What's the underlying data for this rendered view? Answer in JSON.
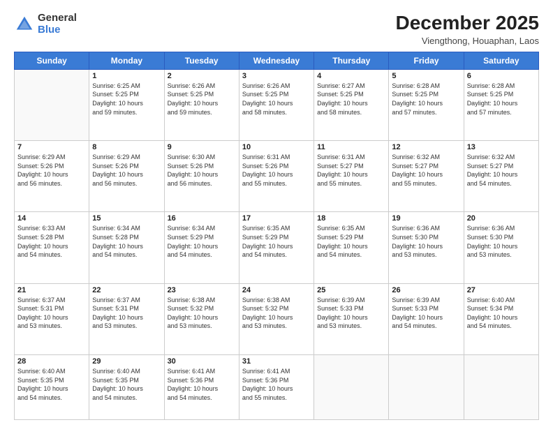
{
  "logo": {
    "general": "General",
    "blue": "Blue"
  },
  "header": {
    "month": "December 2025",
    "subtitle": "Viengthong, Houaphan, Laos"
  },
  "weekdays": [
    "Sunday",
    "Monday",
    "Tuesday",
    "Wednesday",
    "Thursday",
    "Friday",
    "Saturday"
  ],
  "weeks": [
    [
      {
        "day": "",
        "info": ""
      },
      {
        "day": "1",
        "info": "Sunrise: 6:25 AM\nSunset: 5:25 PM\nDaylight: 10 hours\nand 59 minutes."
      },
      {
        "day": "2",
        "info": "Sunrise: 6:26 AM\nSunset: 5:25 PM\nDaylight: 10 hours\nand 59 minutes."
      },
      {
        "day": "3",
        "info": "Sunrise: 6:26 AM\nSunset: 5:25 PM\nDaylight: 10 hours\nand 58 minutes."
      },
      {
        "day": "4",
        "info": "Sunrise: 6:27 AM\nSunset: 5:25 PM\nDaylight: 10 hours\nand 58 minutes."
      },
      {
        "day": "5",
        "info": "Sunrise: 6:28 AM\nSunset: 5:25 PM\nDaylight: 10 hours\nand 57 minutes."
      },
      {
        "day": "6",
        "info": "Sunrise: 6:28 AM\nSunset: 5:25 PM\nDaylight: 10 hours\nand 57 minutes."
      }
    ],
    [
      {
        "day": "7",
        "info": "Sunrise: 6:29 AM\nSunset: 5:26 PM\nDaylight: 10 hours\nand 56 minutes."
      },
      {
        "day": "8",
        "info": "Sunrise: 6:29 AM\nSunset: 5:26 PM\nDaylight: 10 hours\nand 56 minutes."
      },
      {
        "day": "9",
        "info": "Sunrise: 6:30 AM\nSunset: 5:26 PM\nDaylight: 10 hours\nand 56 minutes."
      },
      {
        "day": "10",
        "info": "Sunrise: 6:31 AM\nSunset: 5:26 PM\nDaylight: 10 hours\nand 55 minutes."
      },
      {
        "day": "11",
        "info": "Sunrise: 6:31 AM\nSunset: 5:27 PM\nDaylight: 10 hours\nand 55 minutes."
      },
      {
        "day": "12",
        "info": "Sunrise: 6:32 AM\nSunset: 5:27 PM\nDaylight: 10 hours\nand 55 minutes."
      },
      {
        "day": "13",
        "info": "Sunrise: 6:32 AM\nSunset: 5:27 PM\nDaylight: 10 hours\nand 54 minutes."
      }
    ],
    [
      {
        "day": "14",
        "info": "Sunrise: 6:33 AM\nSunset: 5:28 PM\nDaylight: 10 hours\nand 54 minutes."
      },
      {
        "day": "15",
        "info": "Sunrise: 6:34 AM\nSunset: 5:28 PM\nDaylight: 10 hours\nand 54 minutes."
      },
      {
        "day": "16",
        "info": "Sunrise: 6:34 AM\nSunset: 5:29 PM\nDaylight: 10 hours\nand 54 minutes."
      },
      {
        "day": "17",
        "info": "Sunrise: 6:35 AM\nSunset: 5:29 PM\nDaylight: 10 hours\nand 54 minutes."
      },
      {
        "day": "18",
        "info": "Sunrise: 6:35 AM\nSunset: 5:29 PM\nDaylight: 10 hours\nand 54 minutes."
      },
      {
        "day": "19",
        "info": "Sunrise: 6:36 AM\nSunset: 5:30 PM\nDaylight: 10 hours\nand 53 minutes."
      },
      {
        "day": "20",
        "info": "Sunrise: 6:36 AM\nSunset: 5:30 PM\nDaylight: 10 hours\nand 53 minutes."
      }
    ],
    [
      {
        "day": "21",
        "info": "Sunrise: 6:37 AM\nSunset: 5:31 PM\nDaylight: 10 hours\nand 53 minutes."
      },
      {
        "day": "22",
        "info": "Sunrise: 6:37 AM\nSunset: 5:31 PM\nDaylight: 10 hours\nand 53 minutes."
      },
      {
        "day": "23",
        "info": "Sunrise: 6:38 AM\nSunset: 5:32 PM\nDaylight: 10 hours\nand 53 minutes."
      },
      {
        "day": "24",
        "info": "Sunrise: 6:38 AM\nSunset: 5:32 PM\nDaylight: 10 hours\nand 53 minutes."
      },
      {
        "day": "25",
        "info": "Sunrise: 6:39 AM\nSunset: 5:33 PM\nDaylight: 10 hours\nand 53 minutes."
      },
      {
        "day": "26",
        "info": "Sunrise: 6:39 AM\nSunset: 5:33 PM\nDaylight: 10 hours\nand 54 minutes."
      },
      {
        "day": "27",
        "info": "Sunrise: 6:40 AM\nSunset: 5:34 PM\nDaylight: 10 hours\nand 54 minutes."
      }
    ],
    [
      {
        "day": "28",
        "info": "Sunrise: 6:40 AM\nSunset: 5:35 PM\nDaylight: 10 hours\nand 54 minutes."
      },
      {
        "day": "29",
        "info": "Sunrise: 6:40 AM\nSunset: 5:35 PM\nDaylight: 10 hours\nand 54 minutes."
      },
      {
        "day": "30",
        "info": "Sunrise: 6:41 AM\nSunset: 5:36 PM\nDaylight: 10 hours\nand 54 minutes."
      },
      {
        "day": "31",
        "info": "Sunrise: 6:41 AM\nSunset: 5:36 PM\nDaylight: 10 hours\nand 55 minutes."
      },
      {
        "day": "",
        "info": ""
      },
      {
        "day": "",
        "info": ""
      },
      {
        "day": "",
        "info": ""
      }
    ]
  ]
}
